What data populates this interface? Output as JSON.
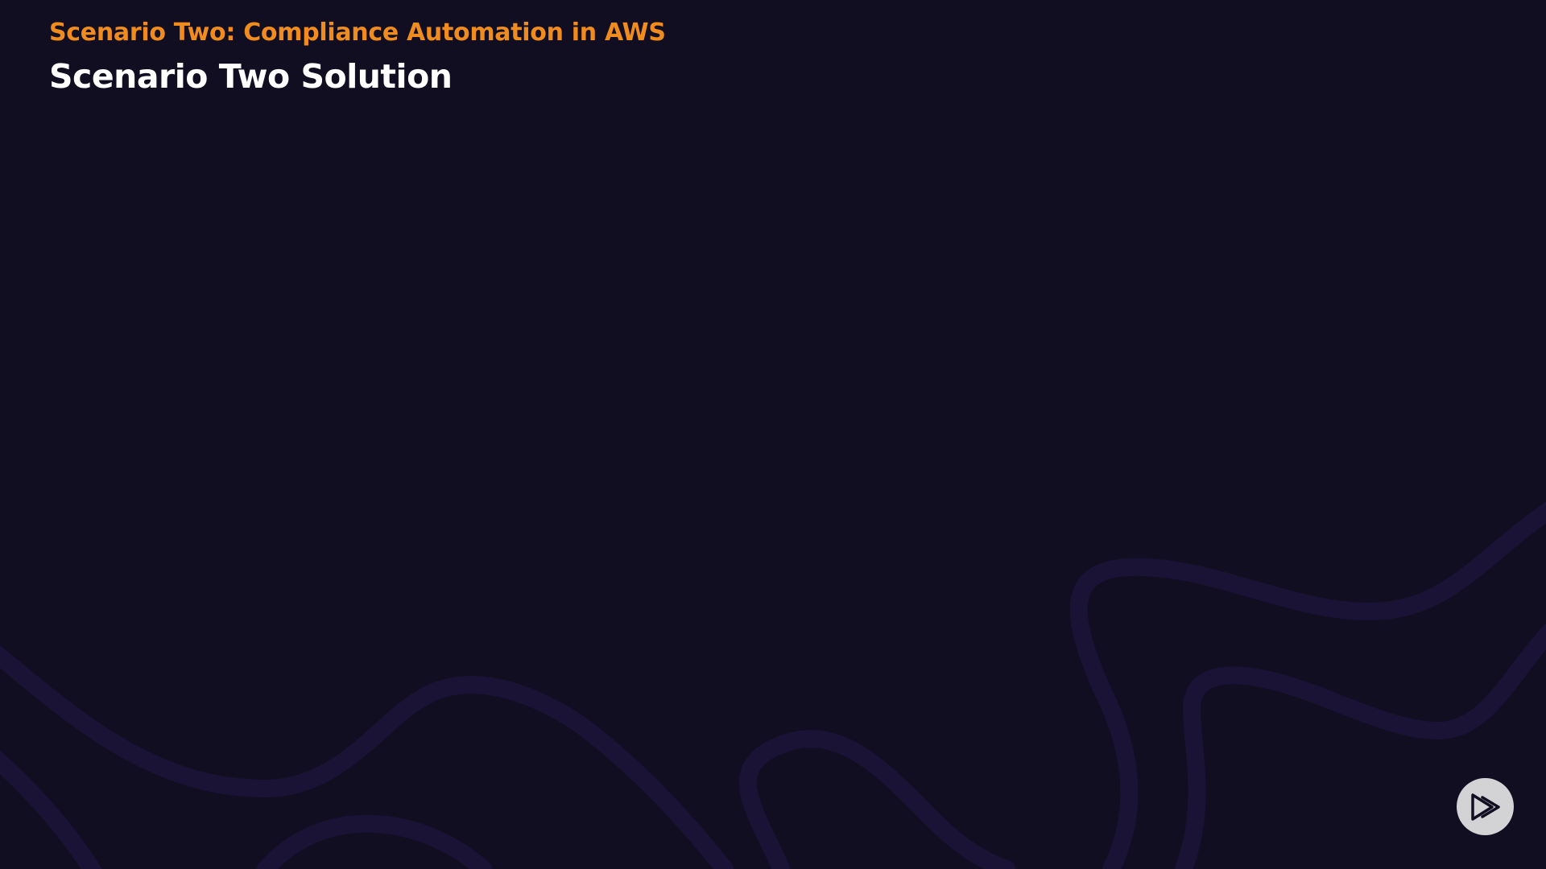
{
  "slide": {
    "section_title": "Scenario Two: Compliance Automation in AWS",
    "title": "Scenario Two Solution"
  },
  "colors": {
    "background": "#120e22",
    "accent": "#f08c1e",
    "title": "#ffffff",
    "wave": "#1a1336",
    "logo_badge": "#d3d3d6"
  },
  "icons": {
    "logo": "play-logo-icon"
  }
}
